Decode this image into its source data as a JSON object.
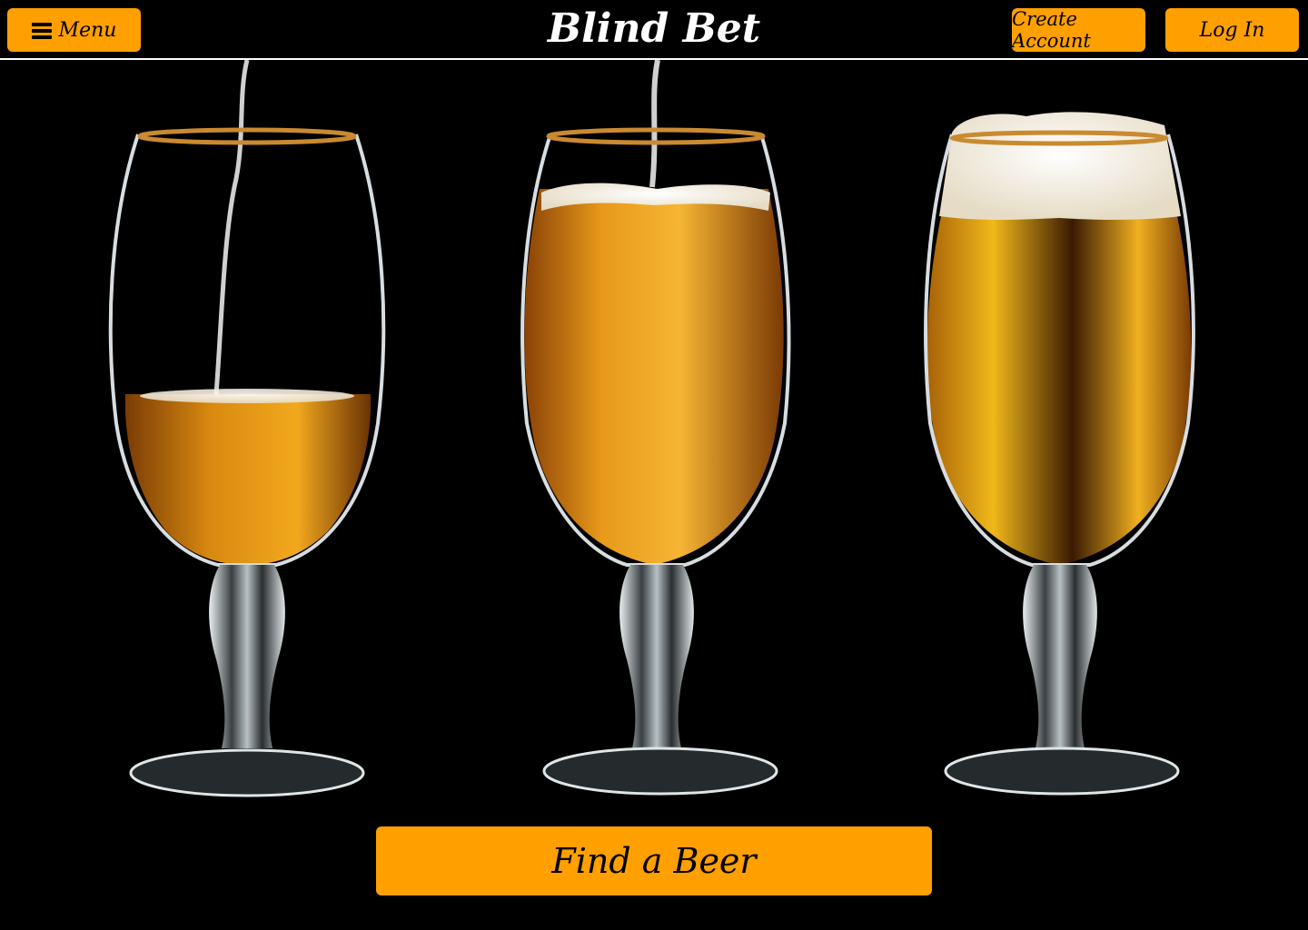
{
  "header": {
    "menu_label": "Menu",
    "title": "Blind Bet",
    "create_account_label": "Create Account",
    "login_label": "Log In"
  },
  "hero": {
    "glasses": [
      "pouring-beer-glass",
      "filling-beer-glass",
      "full-beer-glass"
    ]
  },
  "cta": {
    "find_beer_label": "Find a Beer"
  },
  "colors": {
    "accent": "#ffa000",
    "background": "#000000",
    "header_text": "#ffffff",
    "beer": "#d98a10"
  },
  "icons": {
    "menu": "hamburger-icon"
  }
}
